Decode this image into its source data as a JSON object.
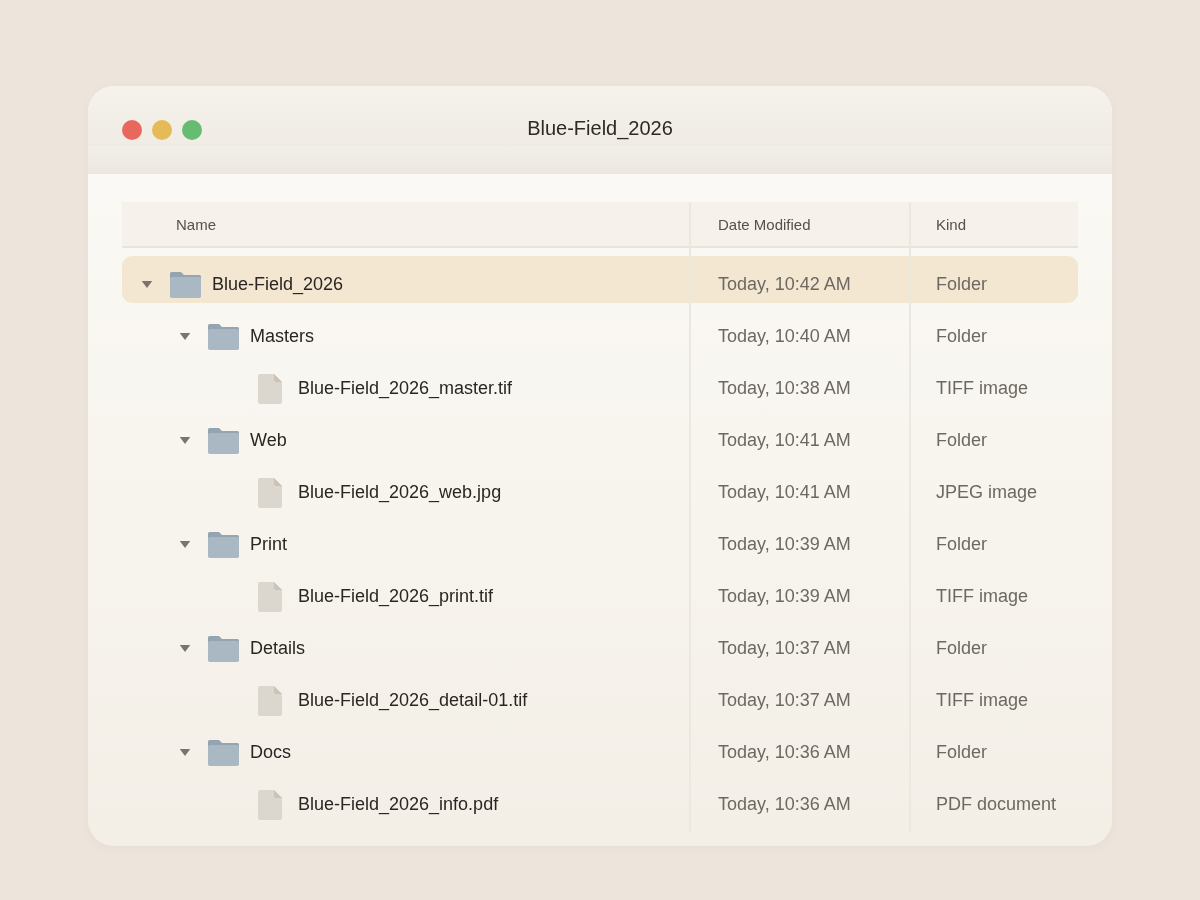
{
  "window": {
    "title": "Blue-Field_2026"
  },
  "table": {
    "columns": [
      {
        "label": "Name"
      },
      {
        "label": "Date Modified"
      },
      {
        "label": "Kind"
      }
    ],
    "rows": [
      {
        "kind": "folder",
        "name": "Blue-Field_2026",
        "date": "Today, 10:42 AM",
        "kind_text": "Folder",
        "expanded": true,
        "selected": true,
        "children": [
          {
            "kind": "folder",
            "name": "Masters",
            "date": "Today, 10:40 AM",
            "kind_text": "Folder",
            "expanded": true,
            "selected": false,
            "children": [
              {
                "kind": "file",
                "name": "Blue-Field_2026_master.tif",
                "date": "Today, 10:38 AM",
                "kind_text": "TIFF image",
                "selected": false
              }
            ]
          },
          {
            "kind": "folder",
            "name": "Web",
            "date": "Today, 10:41 AM",
            "kind_text": "Folder",
            "expanded": true,
            "selected": false,
            "children": [
              {
                "kind": "file",
                "name": "Blue-Field_2026_web.jpg",
                "date": "Today, 10:41 AM",
                "kind_text": "JPEG image",
                "selected": false
              }
            ]
          },
          {
            "kind": "folder",
            "name": "Print",
            "date": "Today, 10:39 AM",
            "kind_text": "Folder",
            "expanded": true,
            "selected": false,
            "children": [
              {
                "kind": "file",
                "name": "Blue-Field_2026_print.tif",
                "date": "Today, 10:39 AM",
                "kind_text": "TIFF image",
                "selected": false
              }
            ]
          },
          {
            "kind": "folder",
            "name": "Details",
            "date": "Today, 10:37 AM",
            "kind_text": "Folder",
            "expanded": true,
            "selected": false,
            "children": [
              {
                "kind": "file",
                "name": "Blue-Field_2026_detail-01.tif",
                "date": "Today, 10:37 AM",
                "kind_text": "TIFF image",
                "selected": false
              }
            ]
          },
          {
            "kind": "folder",
            "name": "Docs",
            "date": "Today, 10:36 AM",
            "kind_text": "Folder",
            "expanded": true,
            "selected": false,
            "children": [
              {
                "kind": "file",
                "name": "Blue-Field_2026_info.pdf",
                "date": "Today, 10:36 AM",
                "kind_text": "PDF document",
                "selected": false
              }
            ]
          }
        ]
      }
    ]
  }
}
